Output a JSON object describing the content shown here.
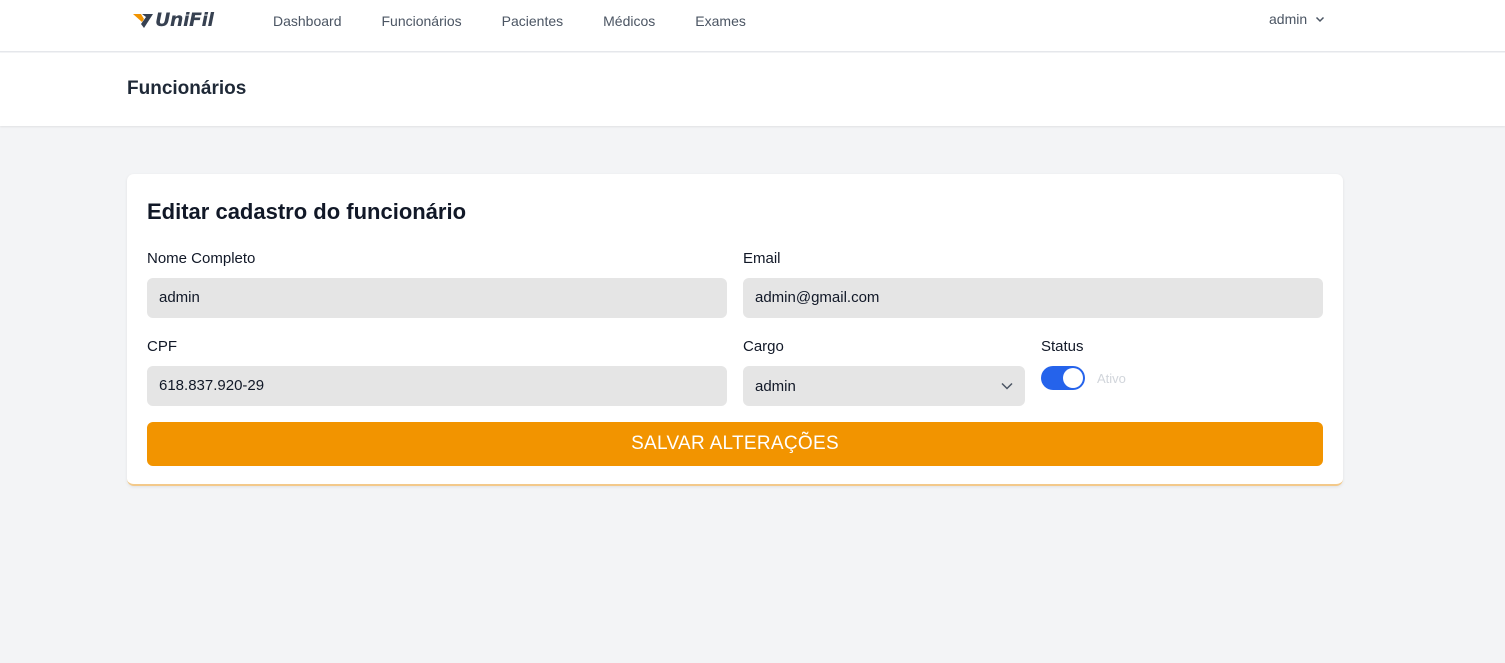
{
  "brand": {
    "name": "UniFil",
    "accent": "#f29400"
  },
  "nav": {
    "items": [
      {
        "label": "Dashboard"
      },
      {
        "label": "Funcionários"
      },
      {
        "label": "Pacientes"
      },
      {
        "label": "Médicos"
      },
      {
        "label": "Exames"
      }
    ],
    "user": {
      "name": "admin",
      "icon": "chevron-down-icon"
    }
  },
  "page": {
    "title": "Funcionários"
  },
  "form": {
    "title": "Editar cadastro do funcionário",
    "nome": {
      "label": "Nome Completo",
      "value": "admin"
    },
    "email": {
      "label": "Email",
      "value": "admin@gmail.com"
    },
    "cpf": {
      "label": "CPF",
      "value": "618.837.920-29"
    },
    "cargo": {
      "label": "Cargo",
      "value": "admin"
    },
    "status": {
      "label": "Status",
      "state_text": "Ativo",
      "on": true,
      "color": "#2563eb"
    },
    "save_label": "SALVAR ALTERAÇÕES"
  }
}
